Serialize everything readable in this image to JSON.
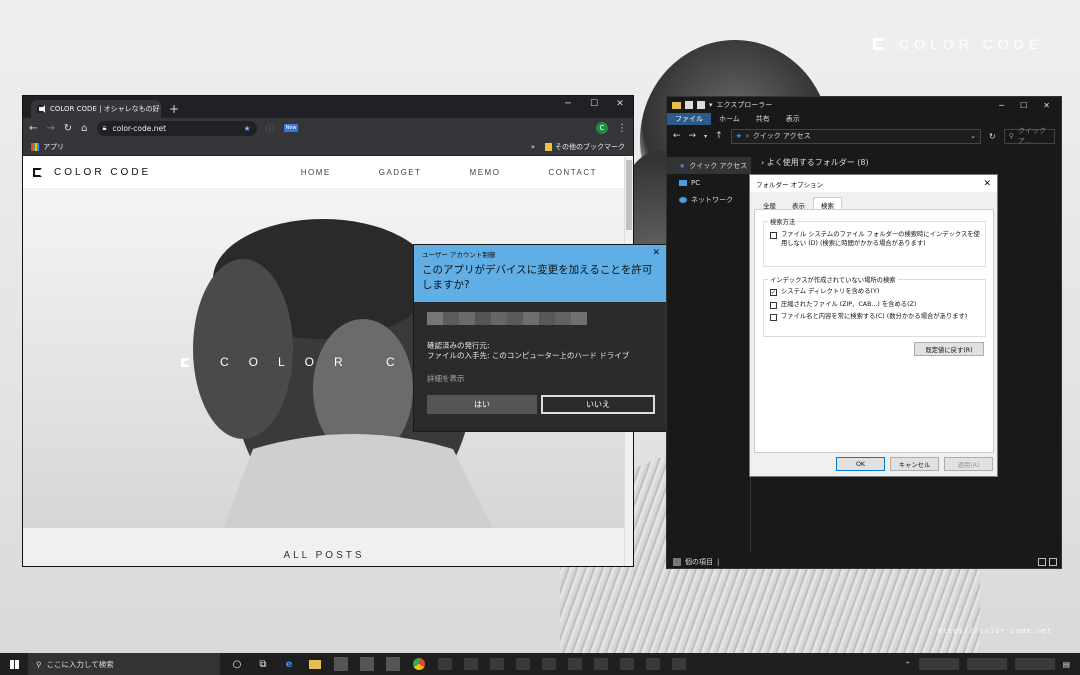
{
  "desktop": {
    "brand": "COLOR CODE",
    "watermark": "https://color-code.net"
  },
  "chrome": {
    "tab_title": "COLOR CODE | オシャレなもの好きの",
    "tab_close": "×",
    "new_tab": "+",
    "controls": [
      "─",
      "☐",
      "✕"
    ],
    "url": "color-code.net",
    "new_badge": "New",
    "avatar_letter": "C",
    "bookmark_apps": "アプリ",
    "bookmark_overflow": "»",
    "bookmark_other": "その他のブックマーク"
  },
  "site": {
    "logo": "COLOR CODE",
    "nav": [
      "HOME",
      "GADGET",
      "MEMO",
      "CONTACT"
    ],
    "hero_brand": "COLOR CO",
    "all_posts": "ALL POSTS"
  },
  "uac": {
    "title": "ユーザー アカウント制御",
    "close": "✕",
    "question": "このアプリがデバイスに変更を加えることを許可しますか?",
    "publisher": "確認済みの発行元:",
    "origin": "ファイルの入手先: このコンピューター上のハード ドライブ",
    "details": "詳細を表示",
    "yes": "はい",
    "no": "いいえ"
  },
  "explorer": {
    "title": "エクスプローラー",
    "ribbon": [
      "ファイル",
      "ホーム",
      "共有",
      "表示"
    ],
    "path": "クイック アクセス",
    "search_placeholder": "クイック ア...",
    "nav": [
      "クイック アクセス",
      "PC",
      "ネットワーク"
    ],
    "frequent": "よく使用するフォルダー (8)",
    "status": "個の項目",
    "controls": [
      "─",
      "☐",
      "✕"
    ]
  },
  "folder_options": {
    "title": "フォルダー オプション",
    "tabs": [
      "全般",
      "表示",
      "検索"
    ],
    "group1": "検索方法",
    "opt1": "ファイル システムのファイル フォルダーの検索時にインデックスを使用しない (D) (検索に時間がかかる場合があります)",
    "group2": "インデックスが作成されていない場所の検索",
    "opt2": "システム ディレクトリを含める(Y)",
    "opt3": "圧縮されたファイル (ZIP、CAB...) を含める(Z)",
    "opt4": "ファイル名と内容を常に検索する(C) (数分かかる場合があります)",
    "restore": "既定値に戻す(R)",
    "ok": "OK",
    "cancel": "キャンセル",
    "apply": "適用(A)"
  },
  "taskbar": {
    "search_placeholder": "ここに入力して検索"
  }
}
